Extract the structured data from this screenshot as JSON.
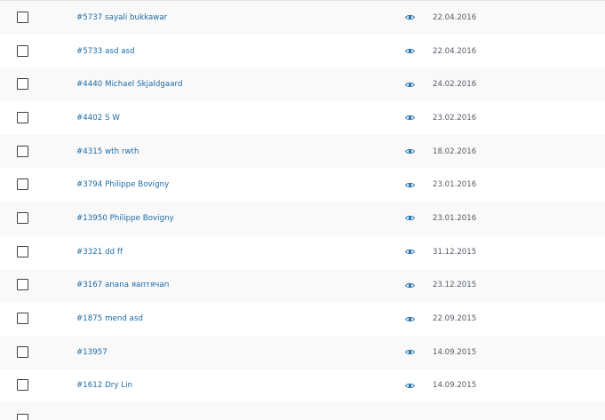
{
  "rows": [
    {
      "title": "#5737 sayali bukkawar",
      "date": "22.04.2016"
    },
    {
      "title": "#5733 asd asd",
      "date": "22.04.2016"
    },
    {
      "title": "#4440 Michael Skjaldgaard",
      "date": "24.02.2016"
    },
    {
      "title": "#4402 S W",
      "date": "23.02.2016"
    },
    {
      "title": "#4315 wth rwth",
      "date": "18.02.2016"
    },
    {
      "title": "#3794 Philippe Bovigny",
      "date": "23.01.2016"
    },
    {
      "title": "#13950 Philippe Bovigny",
      "date": "23.01.2016"
    },
    {
      "title": "#3321 dd ff",
      "date": "31.12.2015"
    },
    {
      "title": "#3167 anana яаптячап",
      "date": "23.12.2015"
    },
    {
      "title": "#1875 mend asd",
      "date": "22.09.2015"
    },
    {
      "title": "#13957",
      "date": "14.09.2015"
    },
    {
      "title": "#1612 Dry Lin",
      "date": "14.09.2015"
    }
  ],
  "colors": {
    "link": "#1a6aa7",
    "date": "#555d66",
    "row_alt": "#f9f9f9",
    "eye_icon": "#1a6aa7"
  },
  "icons": {
    "preview": "eye-icon",
    "select": "checkbox"
  }
}
